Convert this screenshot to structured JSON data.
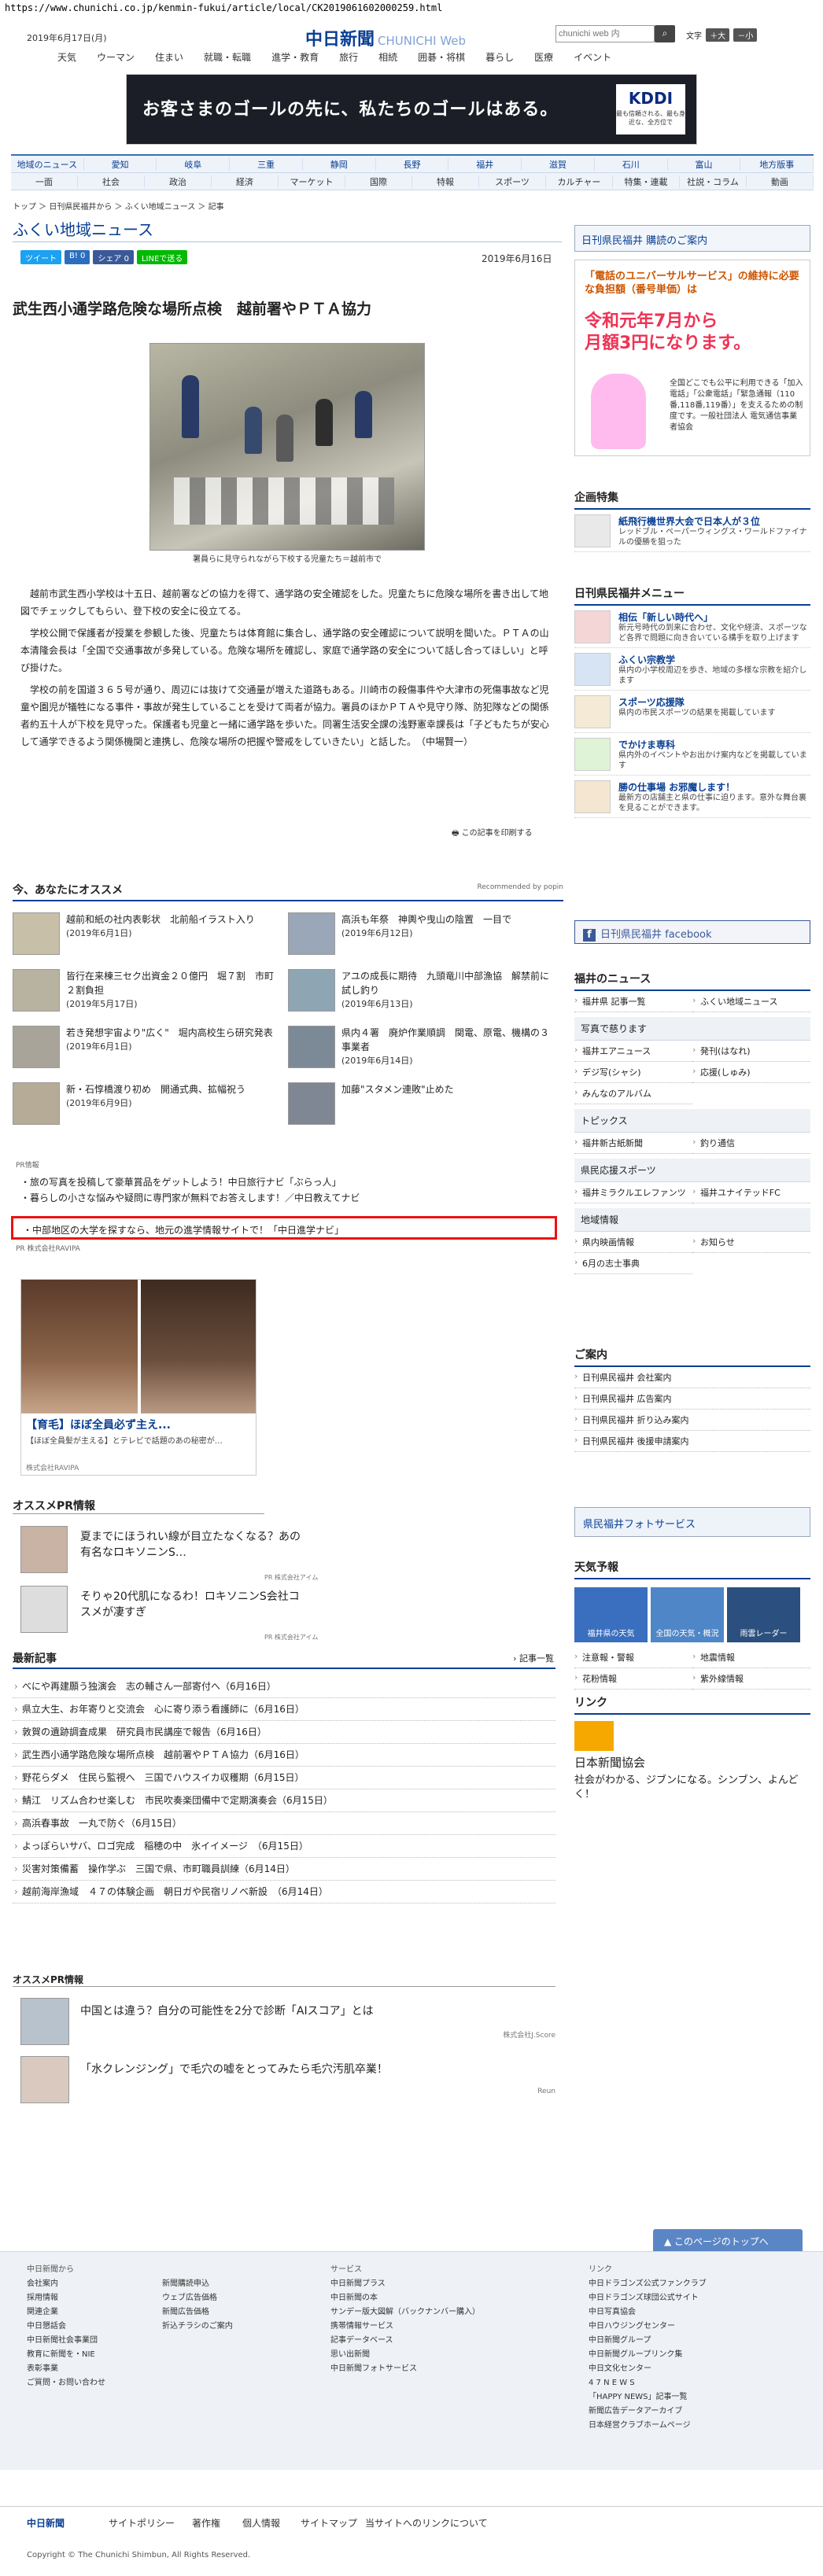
{
  "browser": {
    "url": "https://www.chunichi.co.jp/kenmin-fukui/article/local/CK2019061602000259.html"
  },
  "header": {
    "date": "2019年6月17日(月)",
    "logo_main": "中日新聞",
    "logo_sub": "CHUNICHI Web",
    "search_placeholder": "chunichi web 内",
    "font_label": "文字",
    "font_large": "＋大",
    "font_small": "－小",
    "nav": [
      "天気",
      "ウーマン",
      "住まい",
      "就職・転職",
      "進学・教育",
      "旅行",
      "相続",
      "囲碁・将棋",
      "暮らし",
      "医療",
      "イベント"
    ]
  },
  "banner": {
    "text": "お客さまのゴールの先に、私たちのゴールはある。",
    "brand": "KDDI",
    "brand_sub": "最も信頼される、最も身近な、全方位で"
  },
  "region_nav": {
    "row1": [
      "地域のニュース",
      "愛知",
      "岐阜",
      "三重",
      "静岡",
      "長野",
      "福井",
      "滋賀",
      "石川",
      "富山",
      "地方版事"
    ],
    "row2": [
      "一面",
      "社会",
      "政治",
      "経済",
      "マーケット",
      "国際",
      "特報",
      "スポーツ",
      "カルチャー",
      "特集・連載",
      "社説・コラム",
      "動画"
    ]
  },
  "breadcrumb": "トップ ＞ 日刊県民福井から ＞ ふくい地域ニュース ＞ 記事",
  "page_title": "ふくい地域ニュース",
  "share": {
    "tweet": "ツイート",
    "hatena": "B! 0",
    "fb": "シェア 0",
    "line": "LINEで送る"
  },
  "article": {
    "date": "2019年6月16日",
    "headline": "武生西小通学路危険な場所点検　越前署やＰＴＡ協力",
    "caption": "署員らに見守られながら下校する児童たち＝越前市で",
    "paragraphs": [
      "越前市武生西小学校は十五日、越前署などの協力を得て、通学路の安全確認をした。児童たちに危険な場所を書き出して地図でチェックしてもらい、登下校の安全に役立てる。",
      "学校公開で保護者が授業を参観した後、児童たちは体育館に集合し、通学路の安全確認について説明を聞いた。ＰＴＡの山本清隆会長は「全国で交通事故が多発している。危険な場所を確認し、家庭で通学路の安全について話し合ってほしい」と呼び掛けた。",
      "学校の前を国道３６５号が通り、周辺には抜けて交通量が増えた道路もある。川崎市の殺傷事件や大津市の死傷事故など児童や園児が犠牲になる事件・事故が発生していることを受けて両者が協力。署員のほかＰＴＡや見守り隊、防犯隊などの関係者約五十人が下校を見守った。保護者も児童と一緒に通学路を歩いた。同署生活安全課の浅野憲幸課長は「子どもたちが安心して通学できるよう関係機関と連携し、危険な場所の把握や警戒をしていきたい」と話した。　（中場賢一）"
    ],
    "print": "この記事を印刷する"
  },
  "reco": {
    "title": "今、あなたにオススメ",
    "popin": "Recommended by popin",
    "items": [
      {
        "t": "越前和紙の社内表彰状　北前船イラスト入り",
        "d": "(2019年6月1日)"
      },
      {
        "t": "高浜も年祭　神輿や曳山の陰置　一目で",
        "d": "(2019年6月12日)"
      },
      {
        "t": "皆行在来棟三セク出資金２０億円　堀７割　市町２割負担",
        "d": "(2019年5月17日)"
      },
      {
        "t": "アユの成長に期待　九頭竜川中部漁協　解禁前に試し釣り",
        "d": "(2019年6月13日)"
      },
      {
        "t": "若き発想宇宙より\"広く\"　堀内高校生ら研究発表",
        "d": "(2019年6月1日)"
      },
      {
        "t": "県内４署　廃炉作業順調　関電、原電、機構の３事業者",
        "d": "(2019年6月14日)"
      },
      {
        "t": "新・石惇橋渡り初め　開通式典、拡幅祝う",
        "d": "(2019年6月9日)"
      },
      {
        "t": "加藤\"スタメン連敗\"止めた",
        "d": ""
      }
    ]
  },
  "pr": {
    "label": "PR情報",
    "items": [
      "旅の写真を投稿して豪華賞品をゲットしよう！中日旅行ナビ「ぶらっ人」",
      "暮らしの小さな悩みや疑問に専門家が無料でお答えします！／中日教えてナビ"
    ],
    "highlighted": "中部地区の大学を探すなら、地元の進学情報サイトで！「中日進学ナビ」",
    "sponsor": "PR 株式会社RAVIPA"
  },
  "ad_square": {
    "title": "【育毛】ほぼ全員必ず主え...",
    "sub": "【ほぼ全員髪が主える】とテレビで話題のあの秘密が…",
    "brand": "株式会社RAVIPA"
  },
  "osusume": {
    "title": "オススメPR情報",
    "items": [
      {
        "t": "夏までにほうれい線が目立たなくなる？あの有名なロキソニンS…",
        "s": "PR 株式会社アイム"
      },
      {
        "t": "そりゃ20代肌になるわ！ロキソニンS会社コスメが凄すぎ",
        "s": "PR 株式会社アイム"
      }
    ]
  },
  "latest": {
    "title": "最新記事",
    "more": "記事一覧",
    "items": [
      "べにや再建願う独演会　志の輔さん一部寄付へ（6月16日）",
      "県立大生、お年寄りと交流会　心に寄り添う看護師に（6月16日）",
      "敦賀の遺跡調査成果　研究員市民講座で報告（6月16日）",
      "武生西小通学路危険な場所点検　越前署やＰＴＡ協力（6月16日）",
      "野花らダメ　住民ら監視へ　三国でハウスイカ収穫期（6月15日）",
      "鯖江　リズム合わせ楽しむ　市民吹奏楽団備中で定期演奏会（6月15日）",
      "高浜春事故　一丸で防ぐ（6月15日）",
      "よっぽらいサバ、ロゴ完成　稲穂の中　氷イイメージ　（6月15日）",
      "災害対策備蓄　操作学ぶ　三国で県、市町職員訓練（6月14日）",
      "越前海岸漁域　４７の体験企画　朝日ガや民宿リノベ新設　（6月14日）"
    ]
  },
  "osusume2": {
    "title": "オススメPR情報",
    "items": [
      {
        "t": "中国とは違う？自分の可能性を2分で診断「AIスコア」とは",
        "s": "株式会社J.Score"
      },
      {
        "t": "「水クレンジング」で毛穴の嘘をとってみたら毛穴汚肌卒業！",
        "s": "Reun"
      }
    ]
  },
  "sidebar": {
    "kodoku": "日刊県民福井 購読のご案内",
    "uni_ad": {
      "t1": "「電話のユニバーサルサービス」の維持に必要な負担額（番号単価）は",
      "t2": "令和元年7月から\n月額3円になります。",
      "t3": "全国どこでも公平に利用できる「加入電話」「公衆電話」「緊急通報（110番,118番,119番）」を支えるための制度です。一般社団法人 電気通信事業者協会"
    },
    "kigyo": {
      "title": "企画特集",
      "item_t": "紙飛行機世界大会で日本人が３位",
      "item_s": "レッドブル・ペーパーウィングス・ワールドファイナルの優勝を狙った"
    },
    "menu": {
      "title": "日刊県民福井メニュー",
      "items": [
        {
          "t": "相伝「新しい時代へ」",
          "s": "新元号時代の到来に合わせ、文化や経済、スポーツなど各界で問題に向き合いている構手を取り上げます"
        },
        {
          "t": "ふくい宗教学",
          "s": "県内の小学校周辺を歩き、地域の多様な宗教を紹介します"
        },
        {
          "t": "スポーツ応援隊",
          "s": "県内の市民スポーツの結果を掲載しています"
        },
        {
          "t": "でかけま専科",
          "s": "県内外のイベントやお出かけ案内などを掲載しています"
        },
        {
          "t": "勝の仕事場 お邪魔します！",
          "s": "最新方の店舗主と県の仕事に迫ります。意外な舞台裏を見ることができます。"
        }
      ]
    },
    "facebook": "日刊県民福井 facebook",
    "fukui_news": {
      "title": "福井のニュース",
      "items": [
        "福井県 記事一覧",
        "ふくい地域ニュース"
      ],
      "sub1": "写真で慈ります",
      "sub1_items": [
        "福井エアニュース",
        "発刊(はなれ)",
        "デジ写(シャシ)",
        "応援(しゅみ)",
        "みんなのアルバム"
      ],
      "sub2": "トピックス",
      "sub2_items": [
        "福井新古紙新聞",
        "釣り通信"
      ],
      "sub3": "県民応援スポーツ",
      "sub3_items": [
        "福井ミラクルエレファンツ",
        "福井ユナイテッドFC"
      ],
      "sub4": "地域情報",
      "sub4_items": [
        "県内映画情報",
        "お知らせ",
        "6月の志士事典"
      ]
    },
    "guide": {
      "title": "ご案内",
      "items": [
        "日刊県民福井 会社案内",
        "日刊県民福井 広告案内",
        "日刊県民福井 折り込み案内",
        "日刊県民福井 後援申請案内"
      ]
    },
    "photosvc": "県民福井フォトサービス",
    "weather": {
      "title": "天気予報",
      "tiles": [
        "福井県の天気",
        "全国の天気・概況",
        "雨雲レーダー"
      ],
      "items": [
        "注意報・警報",
        "地震情報",
        "花粉情報",
        "紫外線情報"
      ]
    },
    "link": {
      "title": "リンク",
      "name": "日本新聞協会",
      "desc": "社会がわかる、ジブンになる。シンブン、よんどく！"
    }
  },
  "footer": {
    "totop": "このページのトップへ",
    "col1": [
      "中日新聞から",
      "会社案内",
      "採用情報",
      "関連企業",
      "中日懇話会",
      "中日新聞社会事業団",
      "教育に新聞を・NIE",
      "表彰事業",
      "ご質問・お問い合わせ"
    ],
    "col2": [
      "新聞購読申込",
      "ウェブ広告価格",
      "新聞広告価格",
      "折込チラシのご案内"
    ],
    "col3": [
      "サービス",
      "中日新聞プラス",
      "中日新聞の本",
      "サンデー版大図解（バックナンバー購入）",
      "携帯情報サービス",
      "記事データベース",
      "思い出新聞",
      "中日新聞フォトサービス"
    ],
    "col4": [
      "リンク",
      "中日ドラゴンズ公式ファンクラブ",
      "中日ドラゴンズ球団公式サイト",
      "中日写真協会",
      "中日ハウジングセンター",
      "中日新聞グループ",
      "中日新聞グループリンク集",
      "中日文化センター",
      "4 7 N E W S",
      "「HAPPY NEWS」記事一覧",
      "新聞広告データアーカイブ",
      "日本経営クラブホームページ"
    ],
    "bottom": [
      "中日新聞",
      "サイトポリシー",
      "著作権",
      "個人情報",
      "サイトマップ",
      "当サイトへのリンクについて"
    ],
    "copyright": "Copyright © The Chunichi Shimbun, All Rights Reserved."
  },
  "colors": {
    "brand": "#0a3f93",
    "highlight": "#e11111"
  }
}
